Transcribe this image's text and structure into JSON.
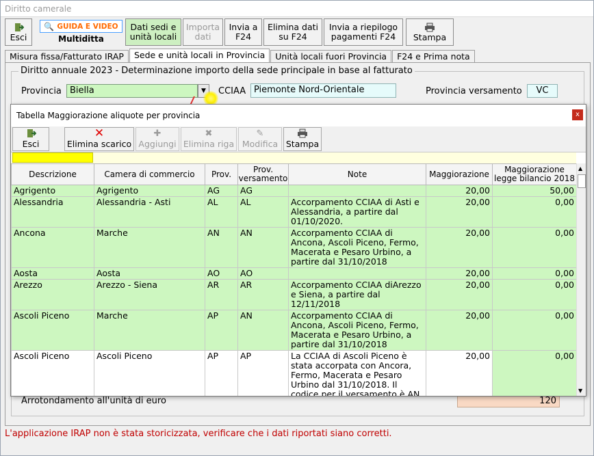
{
  "window": {
    "title": "Diritto camerale"
  },
  "toolbar": {
    "esci": "Esci",
    "guida": "GUIDA E VIDEO",
    "multiditta": "Multiditta",
    "dati_sedi": [
      "Dati sedi e",
      "unità locali"
    ],
    "importa": [
      "Importa",
      "dati"
    ],
    "invia_f24": [
      "Invia a",
      "F24"
    ],
    "elimina_f24": [
      "Elimina dati",
      "su F24"
    ],
    "invia_riepilogo": [
      "Invia a riepilogo",
      "pagamenti F24"
    ],
    "stampa": "Stampa"
  },
  "tabs": [
    "Misura fissa/Fatturato IRAP",
    "Sede e unità locali in Provincia",
    "Unità locali fuori Provincia",
    "F24 e Prima nota"
  ],
  "section": {
    "legend": "Diritto annuale 2023 - Determinazione importo della sede principale in base al fatturato",
    "provincia_label": "Provincia",
    "provincia_value": "Biella",
    "cciaa_label": "CCIAA",
    "cciaa_value": "Piemonte Nord-Orientale",
    "prov_vers_label": "Provincia versamento",
    "prov_vers_value": "VC",
    "arrotondamento_label": "Arrotondamento all'unità di euro",
    "arrotondamento_value": "120"
  },
  "modal": {
    "title": "Tabella Maggiorazione aliquote per provincia",
    "close": "x",
    "buttons": {
      "esci": "Esci",
      "elimina_scarico": "Elimina scarico",
      "aggiungi": "Aggiungi",
      "elimina_riga": "Elimina riga",
      "modifica": "Modifica",
      "stampa": "Stampa"
    },
    "columns": [
      "Descrizione",
      "Camera di commercio",
      "Prov.",
      "Prov. versamento",
      "Note",
      "Maggiorazione",
      "Maggiorazione legge bilancio 2018"
    ],
    "rows": [
      [
        "Agrigento",
        "Agrigento",
        "AG",
        "AG",
        "",
        "20,00",
        "50,00"
      ],
      [
        "Alessandria",
        "Alessandria - Asti",
        "AL",
        "AL",
        "Accorpamento CCIAA di Asti e Alessandria, a partire dal 01/10/2020.",
        "20,00",
        "0,00"
      ],
      [
        "Ancona",
        "Marche",
        "AN",
        "AN",
        "Accorpamento CCIAA di Ancona, Ascoli Piceno, Fermo, Macerata e Pesaro Urbino, a partire dal 31/10/2018",
        "20,00",
        "0,00"
      ],
      [
        "Aosta",
        "Aosta",
        "AO",
        "AO",
        "",
        "20,00",
        "0,00"
      ],
      [
        "Arezzo",
        "Arezzo - Siena",
        "AR",
        "AR",
        "Accorpamento CCIAA diArezzo e Siena, a partire dal 12/11/2018",
        "20,00",
        "0,00"
      ],
      [
        "Ascoli Piceno",
        "Marche",
        "AP",
        "AN",
        "Accorpamento CCIAA di Ancona, Ascoli Piceno, Fermo, Macerata e Pesaro Urbino, a partire dal 31/10/2018",
        "20,00",
        "0,00"
      ],
      [
        "Ascoli Piceno",
        "Ascoli Piceno",
        "AP",
        "AP",
        "La CCIAA di Ascoli Piceno è stata accorpata con Ancora, Fermo, Macerata e Pesaro Urbino dal 31/10/2018. Il codice per il versamento è AN, selezionando questa provincia verrà spostato il",
        "20,00",
        "0,00"
      ]
    ]
  },
  "status": "L'applicazione IRAP non è stata storicizzata, verificare che i dati riportati siano corretti.",
  "colors": {
    "row_green": "#cdf7c0",
    "status_red": "#c00000",
    "filter_yellow": "#ffff00"
  }
}
